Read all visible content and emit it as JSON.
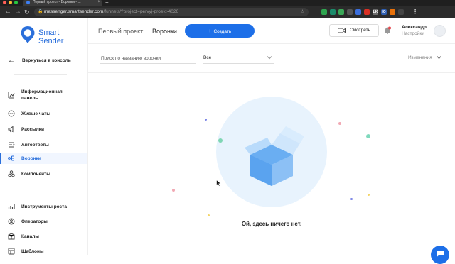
{
  "browser": {
    "tab_title": "Первый проект - Воронки - ...",
    "url_host": "messenger.smartsender.com",
    "url_path": "/funnels/?project=pervyj-proekt-4026",
    "extensions": [
      {
        "icon": "ext-green-icon",
        "color": "#2ea44f",
        "label": ""
      },
      {
        "icon": "ext-teal-icon",
        "color": "#1b8b6b",
        "label": ""
      },
      {
        "icon": "ext-green2-icon",
        "color": "#3aa757",
        "label": ""
      },
      {
        "icon": "ext-gray-icon",
        "color": "#555555",
        "label": ""
      },
      {
        "icon": "ext-blue-icon",
        "color": "#3b6edc",
        "label": ""
      },
      {
        "icon": "ext-red-icon",
        "color": "#d93025",
        "label": ""
      },
      {
        "icon": "ext-lk-icon",
        "color": "#6b6b6b",
        "label": "LK"
      },
      {
        "icon": "ext-iq-icon",
        "color": "#2f5fb3",
        "label": "IQ"
      },
      {
        "icon": "ext-orange-icon",
        "color": "#e8710a",
        "label": ""
      },
      {
        "icon": "ext-puzzle-icon",
        "color": "#444444",
        "label": ""
      }
    ]
  },
  "sidebar": {
    "logo_line1": "Smart",
    "logo_line2": "Sender",
    "back_label": "Вернуться в консоль",
    "items": [
      {
        "label_line1": "Информационная",
        "label_line2": "панель",
        "icon": "chart-icon",
        "active": false
      },
      {
        "label_line1": "Живые чаты",
        "label_line2": "",
        "icon": "chat-icon",
        "active": false
      },
      {
        "label_line1": "Рассылки",
        "label_line2": "",
        "icon": "megaphone-icon",
        "active": false
      },
      {
        "label_line1": "Автоответы",
        "label_line2": "",
        "icon": "bolt-icon",
        "active": false
      },
      {
        "label_line1": "Воронки",
        "label_line2": "",
        "icon": "funnel-icon",
        "active": true
      },
      {
        "label_line1": "Компоненты",
        "label_line2": "",
        "icon": "components-icon",
        "active": false
      },
      {
        "label_line1": "Инструменты роста",
        "label_line2": "",
        "icon": "growth-icon",
        "active": false
      },
      {
        "label_line1": "Операторы",
        "label_line2": "",
        "icon": "operators-icon",
        "active": false
      },
      {
        "label_line1": "Каналы",
        "label_line2": "",
        "icon": "channels-icon",
        "active": false
      },
      {
        "label_line1": "Шаблоны",
        "label_line2": "",
        "icon": "templates-icon",
        "active": false
      }
    ]
  },
  "header": {
    "project": "Первый проект",
    "page": "Воронки",
    "create_label": "Создать",
    "watch_label": "Смотреть",
    "user_name": "Александр",
    "user_settings": "Настройки"
  },
  "filters": {
    "search_placeholder": "Поиск по названию воронки",
    "select_value": "Все",
    "changes_label": "Изменения"
  },
  "content": {
    "empty_text": "Ой, здесь ничего нет."
  },
  "colors": {
    "accent": "#1d6fe8",
    "active_bg": "#f1f6ff",
    "empty_circle": "#e8f3fd"
  }
}
